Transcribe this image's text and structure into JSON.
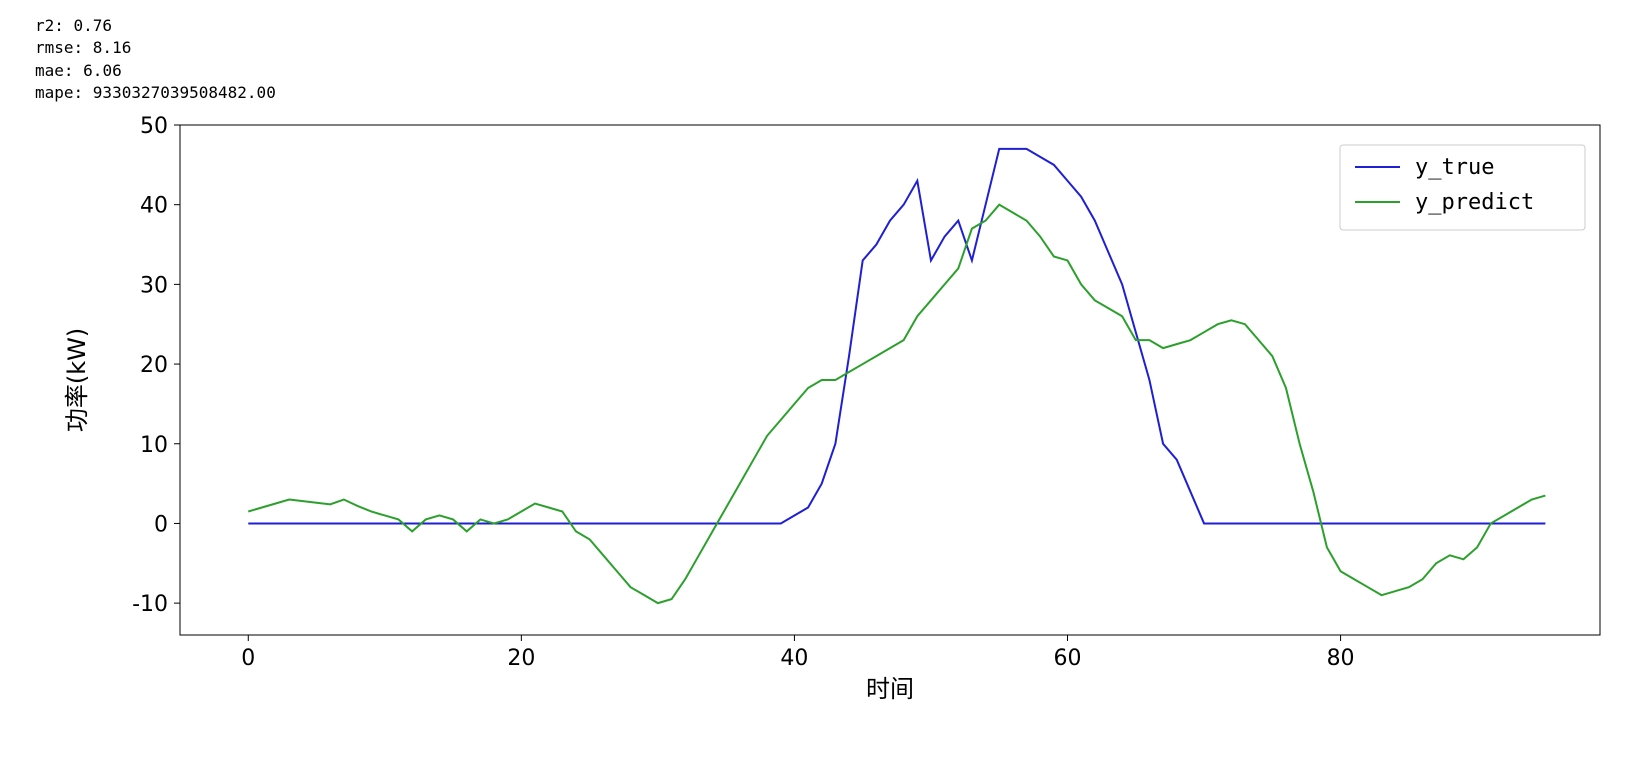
{
  "metrics": {
    "r2_label": "r2: ",
    "r2_value": "0.76",
    "rmse_label": "rmse: ",
    "rmse_value": "8.16",
    "mae_label": "mae: ",
    "mae_value": "6.06",
    "mape_label": "mape: ",
    "mape_value": "9330327039508482.00"
  },
  "chart_data": {
    "type": "line",
    "xlabel": "时间",
    "ylabel": "功率(kW)",
    "xlim": [
      -5,
      99
    ],
    "ylim": [
      -14,
      50
    ],
    "x_ticks": [
      0,
      20,
      40,
      60,
      80
    ],
    "y_ticks": [
      -10,
      0,
      10,
      20,
      30,
      40,
      50
    ],
    "series": [
      {
        "name": "y_true",
        "color": "#1f1fd6",
        "x": [
          0,
          1,
          2,
          3,
          4,
          5,
          6,
          7,
          8,
          9,
          10,
          11,
          12,
          13,
          14,
          15,
          16,
          17,
          18,
          19,
          20,
          21,
          22,
          23,
          24,
          25,
          26,
          27,
          28,
          29,
          30,
          31,
          32,
          33,
          34,
          35,
          36,
          37,
          38,
          39,
          40,
          41,
          42,
          43,
          44,
          45,
          46,
          47,
          48,
          49,
          50,
          51,
          52,
          53,
          54,
          55,
          56,
          57,
          58,
          59,
          60,
          61,
          62,
          63,
          64,
          65,
          66,
          67,
          68,
          69,
          70,
          71,
          72,
          73,
          74,
          75,
          76,
          77,
          78,
          79,
          80,
          81,
          82,
          83,
          84,
          85,
          86,
          87,
          88,
          89,
          90,
          91,
          92,
          93,
          94,
          95
        ],
        "y": [
          0,
          0,
          0,
          0,
          0,
          0,
          0,
          0,
          0,
          0,
          0,
          0,
          0,
          0,
          0,
          0,
          0,
          0,
          0,
          0,
          0,
          0,
          0,
          0,
          0,
          0,
          0,
          0,
          0,
          0,
          0,
          0,
          0,
          0,
          0,
          0,
          0,
          0,
          0,
          0,
          1,
          2,
          5,
          10,
          21,
          33,
          35,
          38,
          40,
          43,
          33,
          36,
          38,
          33,
          40,
          47,
          47,
          47,
          46,
          45,
          43,
          41,
          38,
          34,
          30,
          24,
          18,
          10,
          8,
          4,
          0,
          0,
          0,
          0,
          0,
          0,
          0,
          0,
          0,
          0,
          0,
          0,
          0,
          0,
          0,
          0,
          0,
          0,
          0,
          0,
          0,
          0,
          0,
          0,
          0,
          0
        ]
      },
      {
        "name": "y_predict",
        "color": "#2ca02c",
        "x": [
          0,
          1,
          2,
          3,
          4,
          5,
          6,
          7,
          8,
          9,
          10,
          11,
          12,
          13,
          14,
          15,
          16,
          17,
          18,
          19,
          20,
          21,
          22,
          23,
          24,
          25,
          26,
          27,
          28,
          29,
          30,
          31,
          32,
          33,
          34,
          35,
          36,
          37,
          38,
          39,
          40,
          41,
          42,
          43,
          44,
          45,
          46,
          47,
          48,
          49,
          50,
          51,
          52,
          53,
          54,
          55,
          56,
          57,
          58,
          59,
          60,
          61,
          62,
          63,
          64,
          65,
          66,
          67,
          68,
          69,
          70,
          71,
          72,
          73,
          74,
          75,
          76,
          77,
          78,
          79,
          80,
          81,
          82,
          83,
          84,
          85,
          86,
          87,
          88,
          89,
          90,
          91,
          92,
          93,
          94,
          95
        ],
        "y": [
          1.5,
          2,
          2.5,
          3,
          2.8,
          2.6,
          2.4,
          3,
          2.2,
          1.5,
          1,
          0.5,
          -1,
          0.5,
          1,
          0.5,
          -1,
          0.5,
          0,
          0.5,
          1.5,
          2.5,
          2,
          1.5,
          -1,
          -2,
          -4,
          -6,
          -8,
          -9,
          -10,
          -9.5,
          -7,
          -4,
          -1,
          2,
          5,
          8,
          11,
          13,
          15,
          17,
          18,
          18,
          19,
          20,
          21,
          22,
          23,
          26,
          28,
          30,
          32,
          37,
          38,
          40,
          39,
          38,
          36,
          33.5,
          33,
          30,
          28,
          27,
          26,
          23,
          23,
          22,
          22.5,
          23,
          24,
          25,
          25.5,
          25,
          23,
          21,
          17,
          10,
          4,
          -3,
          -6,
          -7,
          -8,
          -9,
          -8.5,
          -8,
          -7,
          -5,
          -4,
          -4.5,
          -3,
          0,
          1,
          2,
          3,
          3.5
        ]
      }
    ],
    "legend": {
      "items": [
        "y_true",
        "y_predict"
      ],
      "position": "upper right"
    }
  }
}
